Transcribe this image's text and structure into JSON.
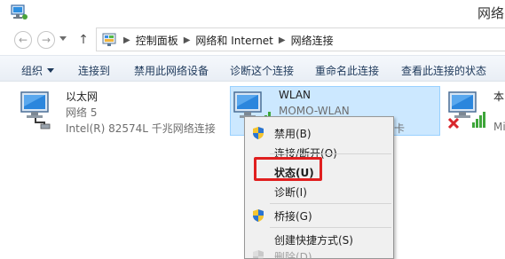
{
  "window": {
    "title": "网络",
    "title_icon": "network-icon"
  },
  "address": {
    "crumbs": [
      "控制面板",
      "网络和 Internet",
      "网络连接"
    ],
    "icon": "control-panel-icon"
  },
  "toolbar": {
    "organize": "组织",
    "connect_to": "连接到",
    "disable_device": "禁用此网络设备",
    "diagnose": "诊断这个连接",
    "rename": "重命名此连接",
    "view_status": "查看此连接的状态"
  },
  "adapters": [
    {
      "name": "以太网",
      "network": "网络 5",
      "device": "Intel(R) 82574L 千兆网络连接",
      "icon": "ethernet-adapter-icon"
    },
    {
      "name": "WLAN",
      "network": "MOMO-WLAN",
      "device": "卡",
      "icon": "wifi-adapter-icon"
    },
    {
      "name": "本",
      "network": "",
      "device": "Mi",
      "icon": "wifi-adapter-disconnected-icon"
    }
  ],
  "context_menu": {
    "items": [
      {
        "label": "禁用(B)",
        "icon": "uac-shield-icon"
      },
      {
        "label": "连接/断开(O)"
      },
      {
        "label": "状态(U)",
        "bold": true
      },
      {
        "label": "诊断(I)"
      },
      {
        "label": "桥接(G)",
        "icon": "uac-shield-icon"
      },
      {
        "label": "创建快捷方式(S)"
      },
      {
        "label": "删除(D)",
        "icon": "uac-shield-icon",
        "disabled": true
      }
    ]
  },
  "colors": {
    "selection_bg": "#cce8ff",
    "selection_border": "#99d1ff",
    "highlight_box": "#e01f1f",
    "command_text": "#1e395b"
  }
}
